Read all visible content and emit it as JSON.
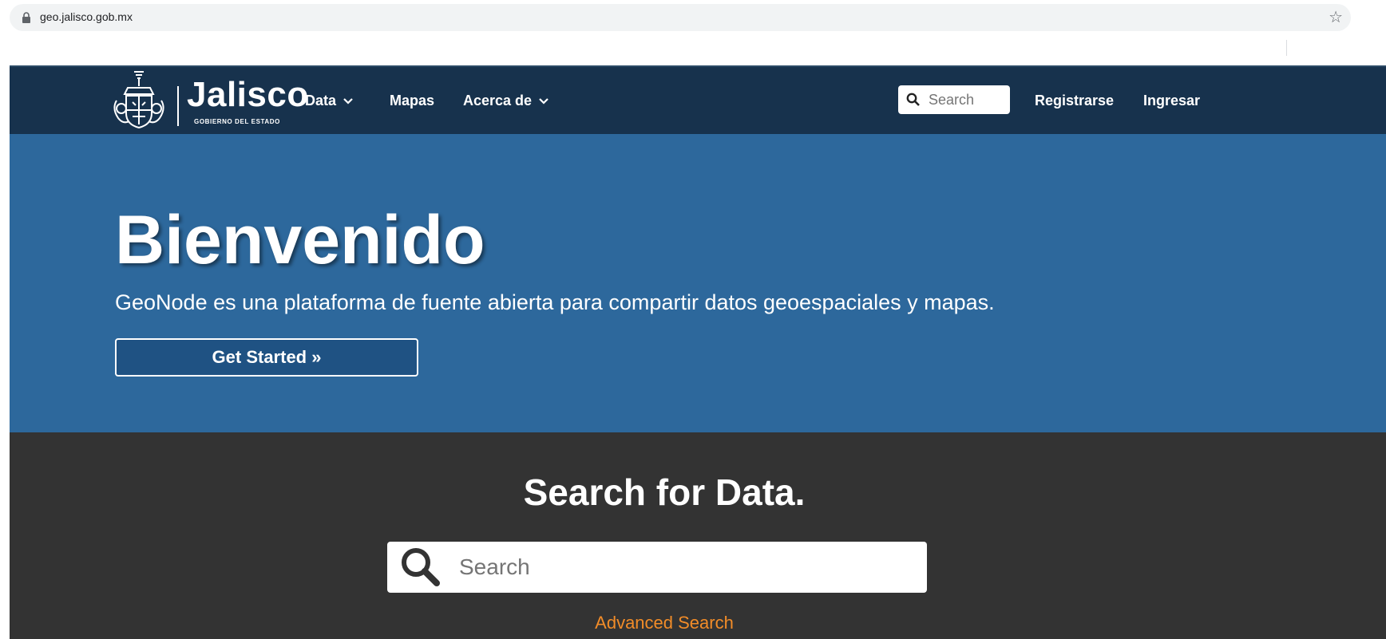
{
  "browser": {
    "url": "geo.jalisco.gob.mx"
  },
  "navbar": {
    "logo_word": "Jalisco",
    "logo_subtitle": "GOBIERNO DEL ESTADO",
    "items": [
      {
        "label": "Data"
      },
      {
        "label": "Mapas"
      },
      {
        "label": "Acerca de"
      }
    ],
    "search_placeholder": "Search",
    "register_label": "Registrarse",
    "login_label": "Ingresar"
  },
  "hero": {
    "title": "Bienvenido",
    "subtitle": "GeoNode es una plataforma de fuente abierta para compartir datos geoespaciales y mapas.",
    "button_label": "Get Started »"
  },
  "search_section": {
    "title": "Search for Data.",
    "placeholder": "Search",
    "advanced_label": "Advanced Search"
  },
  "colors": {
    "navbar_bg": "#17324d",
    "hero_bg": "#2d689c",
    "button_bg": "#1f5283",
    "search_section_bg": "#333333",
    "accent_link": "#f28c28"
  },
  "icons": {
    "lock": "lock-icon",
    "star": "star-icon",
    "search": "search-icon",
    "chevron": "chevron-down-icon",
    "emblem": "coat-of-arms-icon"
  }
}
